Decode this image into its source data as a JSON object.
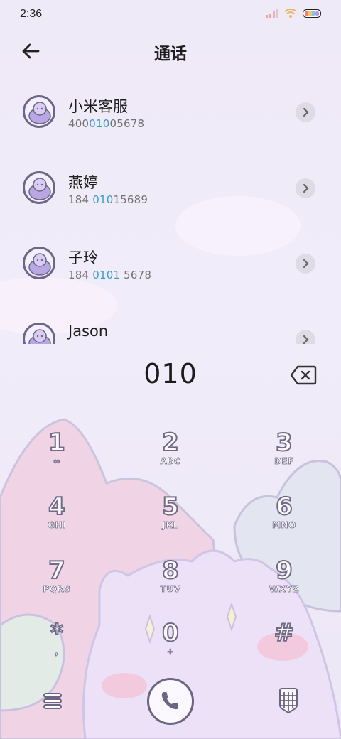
{
  "status_bar": {
    "time": "2:36"
  },
  "header": {
    "title": "通话"
  },
  "contacts": [
    {
      "name": "小米客服",
      "num_pre": "400",
      "num_hl": "010",
      "num_post": "05678"
    },
    {
      "name": "燕婷",
      "num_pre": "184 ",
      "num_hl": "010",
      "num_post": "15689"
    },
    {
      "name": "子玲",
      "num_pre": "184 ",
      "num_hl": "0101",
      "num_post": " 5678"
    },
    {
      "name": "Jason",
      "num_pre": "",
      "num_hl": "",
      "num_post": ""
    }
  ],
  "dialer": {
    "number": "010"
  },
  "keypad": [
    {
      "digit": "1",
      "letters": "∞"
    },
    {
      "digit": "2",
      "letters": "ABC"
    },
    {
      "digit": "3",
      "letters": "DEF"
    },
    {
      "digit": "4",
      "letters": "GHI"
    },
    {
      "digit": "5",
      "letters": "JKL"
    },
    {
      "digit": "6",
      "letters": "MNO"
    },
    {
      "digit": "7",
      "letters": "PQRS"
    },
    {
      "digit": "8",
      "letters": "TUV"
    },
    {
      "digit": "9",
      "letters": "WXYZ"
    },
    {
      "digit": "*",
      "letters": ","
    },
    {
      "digit": "0",
      "letters": "+"
    },
    {
      "digit": "#",
      "letters": ""
    }
  ],
  "colors": {
    "accent": "#3a9ad0",
    "outline": "#6c6785",
    "background": "#efeaf8"
  },
  "icons": {
    "back": "arrow-left-icon",
    "backspace": "backspace-icon",
    "menu": "menu-icon",
    "call": "phone-icon",
    "keypad": "dialpad-icon"
  }
}
